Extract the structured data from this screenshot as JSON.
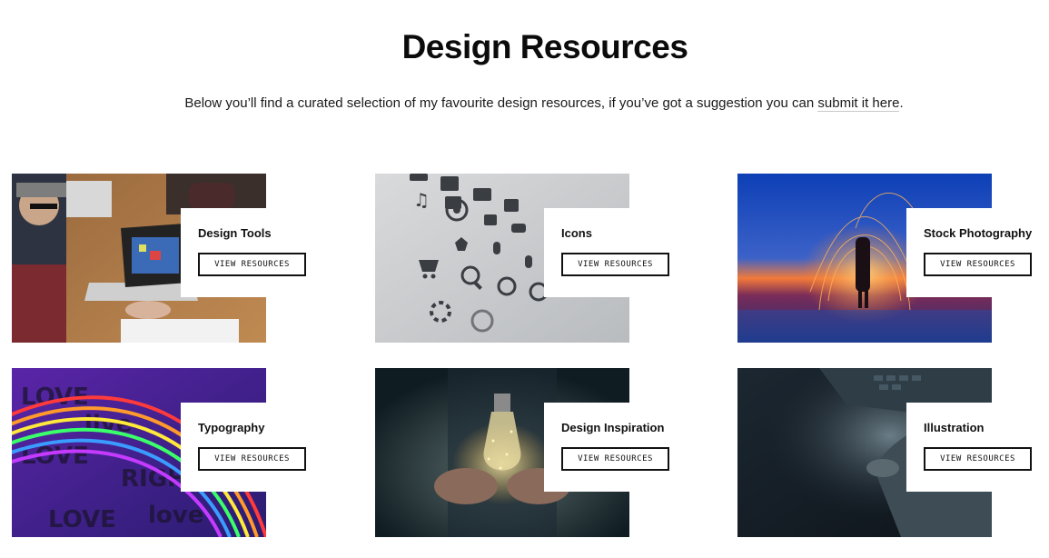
{
  "page": {
    "title": "Design Resources",
    "intro_text": "Below you’ll find a curated selection of my favourite design resources, if you’ve got a suggestion you can ",
    "intro_link": "submit it here",
    "intro_end": "."
  },
  "cards": [
    {
      "name": "Design Tools",
      "button": "VIEW RESOURCES"
    },
    {
      "name": "Icons",
      "button": "VIEW RESOURCES"
    },
    {
      "name": "Stock Photography",
      "button": "VIEW RESOURCES"
    },
    {
      "name": "Typography",
      "button": "VIEW RESOURCES"
    },
    {
      "name": "Design Inspiration",
      "button": "VIEW RESOURCES"
    },
    {
      "name": "Illustration",
      "button": "VIEW RESOURCES"
    }
  ]
}
